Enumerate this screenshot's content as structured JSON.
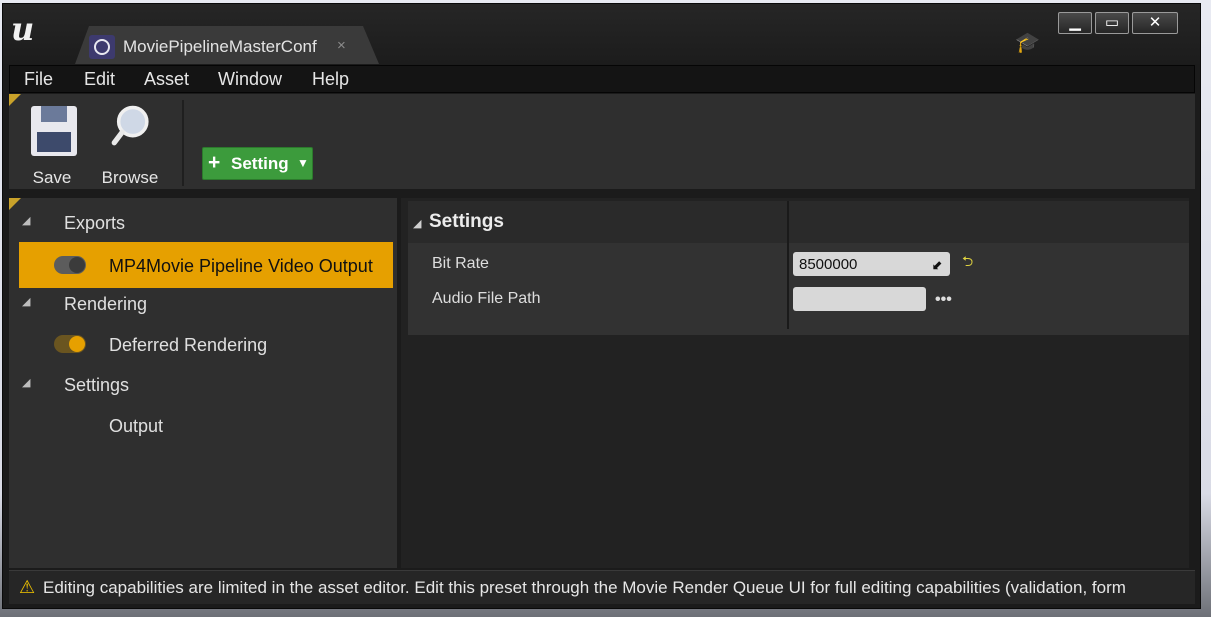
{
  "window": {
    "tab_title": "MoviePipelineMasterConf",
    "tab_close_glyph": "×",
    "controls": {
      "minimize": "▁",
      "maximize": "▭",
      "close": "✕"
    },
    "colors": {
      "accent": "#e6a000",
      "add_button": "#3c9b3c",
      "warning": "#f2c500"
    }
  },
  "menu": {
    "items": [
      "File",
      "Edit",
      "Asset",
      "Window",
      "Help"
    ]
  },
  "toolbar": {
    "save_label": "Save",
    "save_icon": "floppy-disk-icon",
    "browse_label": "Browse",
    "browse_icon": "magnifier-icon",
    "add_setting": {
      "glyph": "+",
      "label": "Setting",
      "caret": "▼"
    }
  },
  "settings_tree": {
    "sections": [
      {
        "label": "Exports",
        "items": [
          {
            "label": "MP4Movie Pipeline Video Output",
            "enabled": false,
            "selected": true
          }
        ]
      },
      {
        "label": "Rendering",
        "items": [
          {
            "label": "Deferred Rendering",
            "enabled": true,
            "selected": false
          }
        ]
      },
      {
        "label": "Settings",
        "items": [
          {
            "label": "Output"
          }
        ]
      }
    ],
    "expander_glyph": "◢"
  },
  "details": {
    "section_title": "Settings",
    "properties": [
      {
        "label": "Bit Rate",
        "value": "8500000"
      },
      {
        "label": "Audio File Path",
        "value": ""
      }
    ],
    "reset_icon": "reset-to-default-icon",
    "browse_glyph": "•••",
    "spin_glyph": "⬋"
  },
  "status": {
    "icon": "warning-icon",
    "message": "Editing capabilities are limited in the asset editor. Edit this preset through the Movie Render Queue UI for full editing capabilities (validation, form"
  }
}
